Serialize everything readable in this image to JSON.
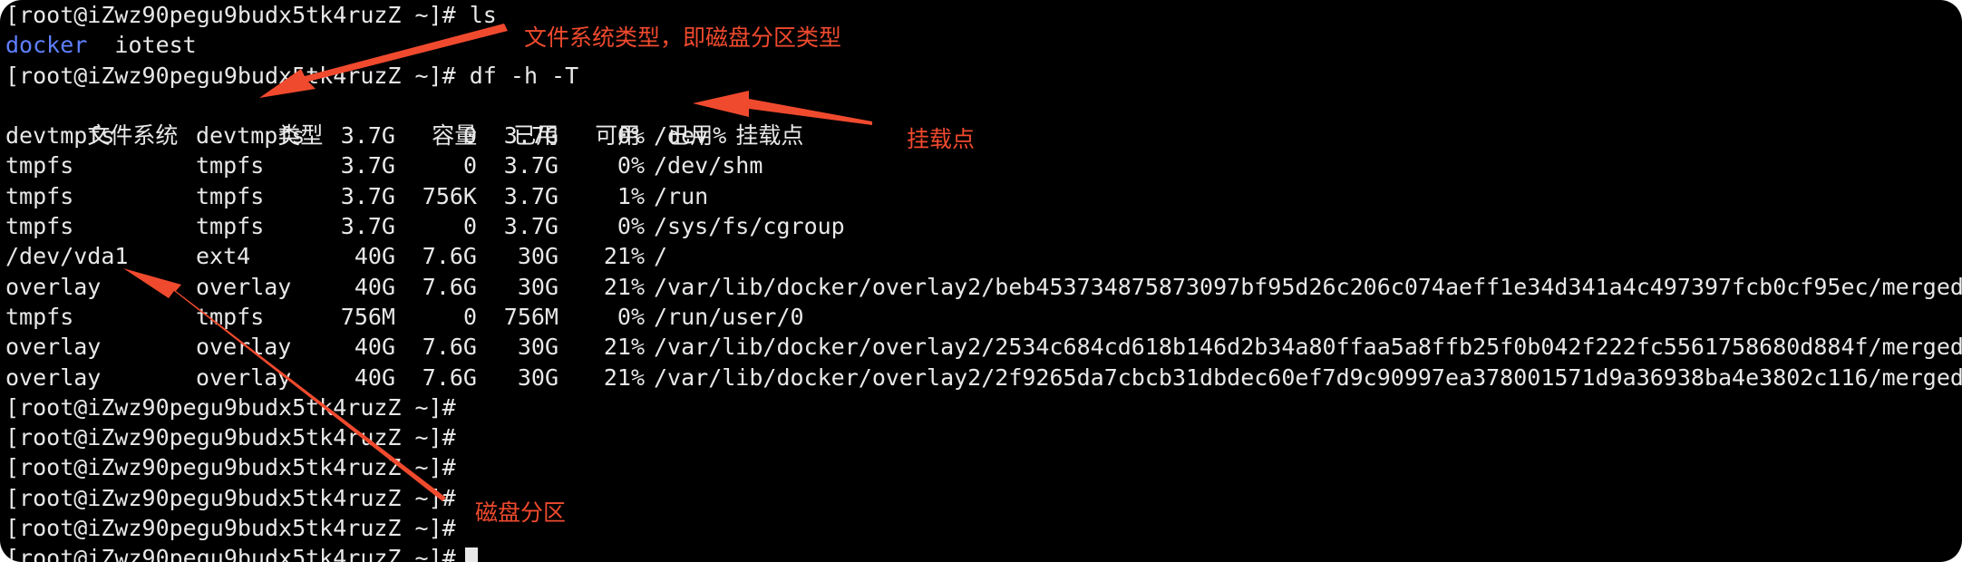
{
  "prompt": "[root@iZwz90pegu9budx5tk4ruzZ ~]#",
  "lines_top": [
    {
      "cmd": " ls"
    },
    {
      "items": [
        "docker",
        "  iotest"
      ]
    },
    {
      "cmd": " df -h -T"
    }
  ],
  "df_header": [
    "文件系统",
    "类型",
    "容量",
    "已用",
    "可用",
    "已用%",
    "挂载点"
  ],
  "df_rows": [
    [
      "devtmpfs",
      "devtmpfs",
      "3.7G",
      "0",
      "3.7G",
      "0%",
      "/dev"
    ],
    [
      "tmpfs",
      "tmpfs",
      "3.7G",
      "0",
      "3.7G",
      "0%",
      "/dev/shm"
    ],
    [
      "tmpfs",
      "tmpfs",
      "3.7G",
      "756K",
      "3.7G",
      "1%",
      "/run"
    ],
    [
      "tmpfs",
      "tmpfs",
      "3.7G",
      "0",
      "3.7G",
      "0%",
      "/sys/fs/cgroup"
    ],
    [
      "/dev/vda1",
      "ext4",
      "40G",
      "7.6G",
      "30G",
      "21%",
      "/"
    ],
    [
      "overlay",
      "overlay",
      "40G",
      "7.6G",
      "30G",
      "21%",
      "/var/lib/docker/overlay2/beb453734875873097bf95d26c206c074aeff1e34d341a4c497397fcb0cf95ec/merged"
    ],
    [
      "tmpfs",
      "tmpfs",
      "756M",
      "0",
      "756M",
      "0%",
      "/run/user/0"
    ],
    [
      "overlay",
      "overlay",
      "40G",
      "7.6G",
      "30G",
      "21%",
      "/var/lib/docker/overlay2/2534c684cd618b146d2b34a80ffaa5a8ffb25f0b042f222fc5561758680d884f/merged"
    ],
    [
      "overlay",
      "overlay",
      "40G",
      "7.6G",
      "30G",
      "21%",
      "/var/lib/docker/overlay2/2f9265da7cbcb31dbdec60ef7d9c90997ea378001571d9a36938ba4e3802c116/merged"
    ]
  ],
  "annotations": {
    "fs_type": "文件系统类型，即磁盘分区类型",
    "mount_point": "挂载点",
    "disk_partition": "磁盘分区"
  },
  "colors": {
    "annotation": "#f04a2e",
    "dir": "#5f7fff"
  }
}
